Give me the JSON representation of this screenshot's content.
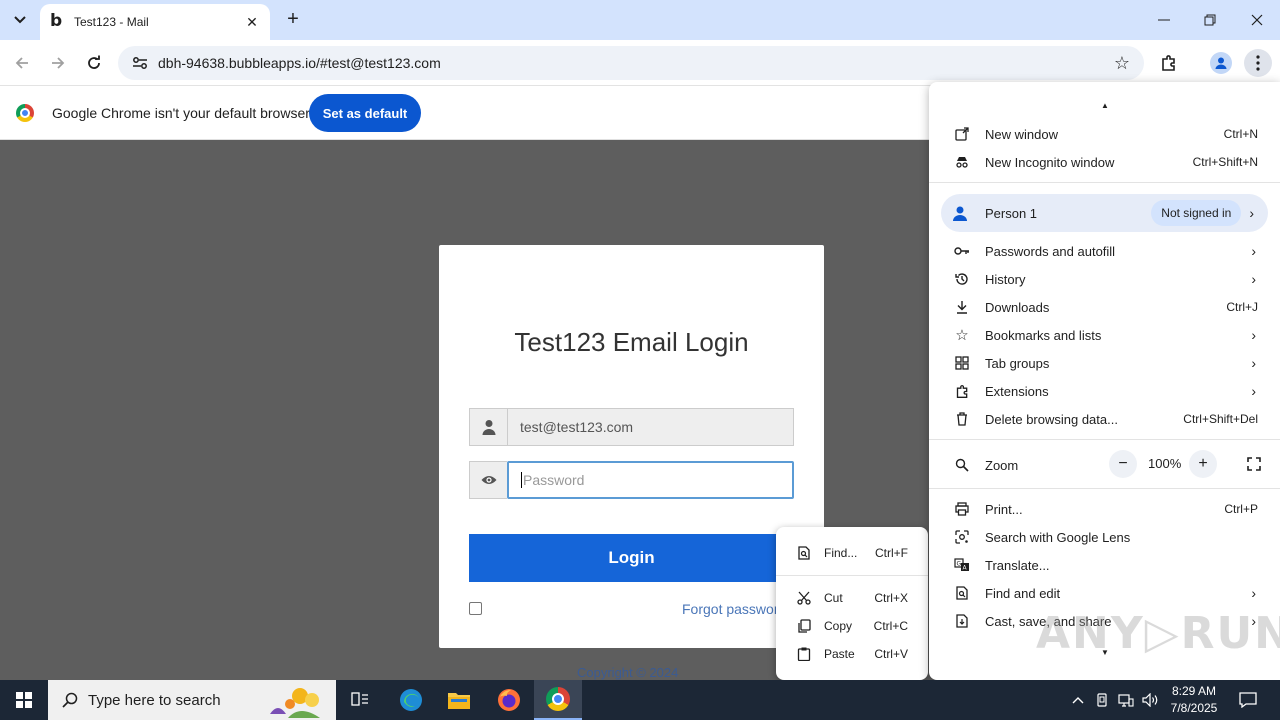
{
  "browser": {
    "tab": {
      "title": "Test123 - Mail",
      "favicon_text": "b"
    },
    "url": "dbh-94638.bubbleapps.io/#test@test123.com",
    "infobar": {
      "message": "Google Chrome isn't your default browser",
      "button": "Set as default"
    }
  },
  "page": {
    "login": {
      "title": "Test123 Email Login",
      "email_value": "test@test123.com",
      "password_placeholder": "Password",
      "login_button": "Login",
      "forgot_link": "Forgot password",
      "copyright": "Copyright © 2024"
    }
  },
  "context_menu": {
    "items": [
      {
        "label": "Find...",
        "shortcut": "Ctrl+F",
        "icon": "find-icon"
      },
      {
        "label": "Cut",
        "shortcut": "Ctrl+X",
        "icon": "scissors-icon"
      },
      {
        "label": "Copy",
        "shortcut": "Ctrl+C",
        "icon": "copy-icon"
      },
      {
        "label": "Paste",
        "shortcut": "Ctrl+V",
        "icon": "paste-icon"
      }
    ]
  },
  "chrome_menu": {
    "new_window": {
      "label": "New window",
      "shortcut": "Ctrl+N"
    },
    "new_incognito": {
      "label": "New Incognito window",
      "shortcut": "Ctrl+Shift+N"
    },
    "person": {
      "label": "Person 1",
      "status": "Not signed in"
    },
    "passwords": {
      "label": "Passwords and autofill"
    },
    "history": {
      "label": "History"
    },
    "downloads": {
      "label": "Downloads",
      "shortcut": "Ctrl+J"
    },
    "bookmarks": {
      "label": "Bookmarks and lists"
    },
    "tab_groups": {
      "label": "Tab groups"
    },
    "extensions": {
      "label": "Extensions"
    },
    "delete_data": {
      "label": "Delete browsing data...",
      "shortcut": "Ctrl+Shift+Del"
    },
    "zoom": {
      "label": "Zoom",
      "value": "100%",
      "minus": "−",
      "plus": "+"
    },
    "print": {
      "label": "Print...",
      "shortcut": "Ctrl+P"
    },
    "lens": {
      "label": "Search with Google Lens"
    },
    "translate": {
      "label": "Translate..."
    },
    "find_edit": {
      "label": "Find and edit"
    },
    "cast": {
      "label": "Cast, save, and share"
    }
  },
  "watermark": "ANY▷RUN",
  "taskbar": {
    "search_placeholder": "Type here to search",
    "time": "8:29 AM",
    "date": "7/8/2025"
  },
  "colors": {
    "tabstrip": "#d3e3fd",
    "accent_blue": "#0b57d0",
    "login_button": "#1565d8",
    "page_overlay": "#5e5e5e",
    "taskbar": "#1c2736"
  }
}
